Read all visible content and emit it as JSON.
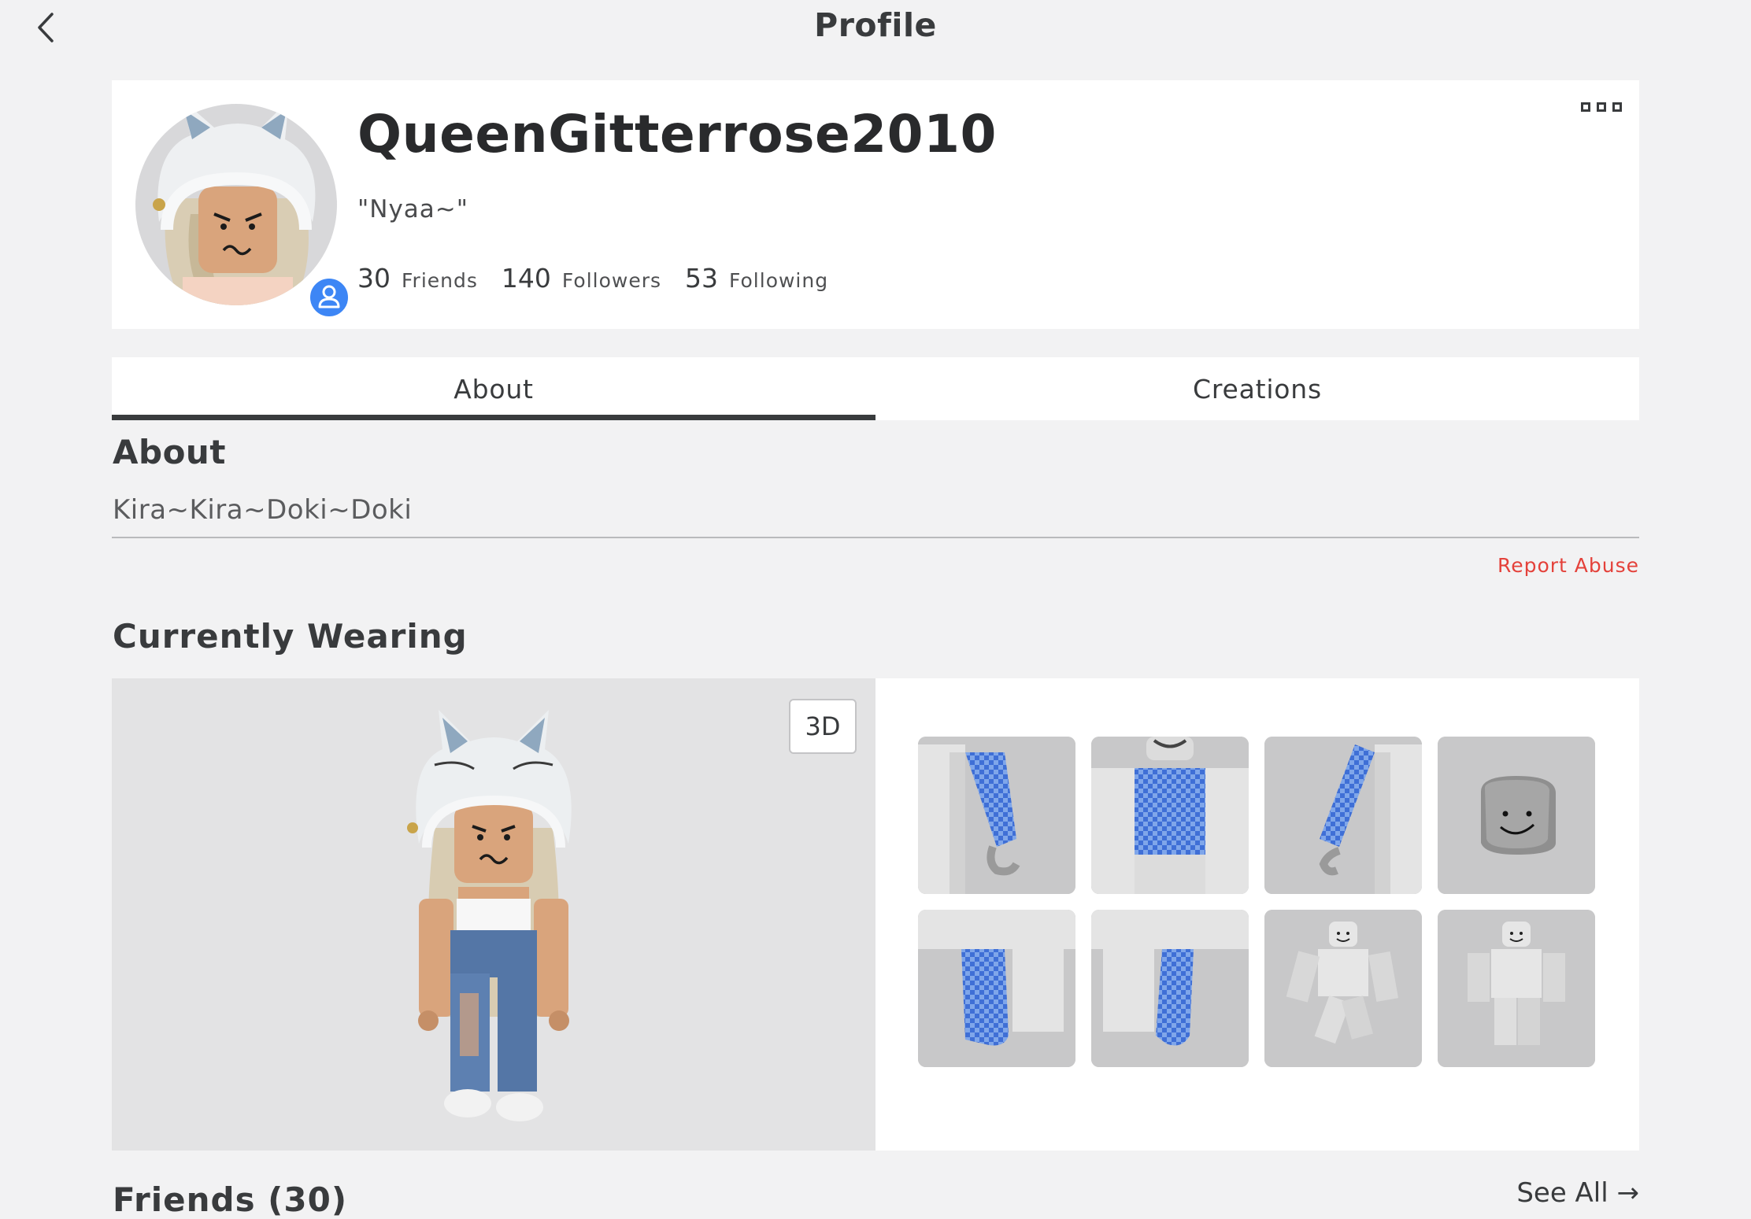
{
  "nav": {
    "title": "Profile"
  },
  "profile": {
    "username": "QueenGitterrose2010",
    "display_name": "\"Nyaa~\"",
    "stats": [
      {
        "count": "30",
        "label": "Friends"
      },
      {
        "count": "140",
        "label": "Followers"
      },
      {
        "count": "53",
        "label": "Following"
      }
    ]
  },
  "tabs": [
    {
      "label": "About",
      "active": true
    },
    {
      "label": "Creations",
      "active": false
    }
  ],
  "about": {
    "heading": "About",
    "text": "Kira~Kira~Doki~Doki",
    "report_label": "Report Abuse"
  },
  "wearing": {
    "heading": "Currently Wearing",
    "toggle_3d_label": "3D",
    "items": [
      {
        "icon": "left-arm-blue-checker"
      },
      {
        "icon": "torso-blue-checker"
      },
      {
        "icon": "right-arm-blue-checker"
      },
      {
        "icon": "smiley-head"
      },
      {
        "icon": "left-leg-blue-checker"
      },
      {
        "icon": "right-leg-blue-checker"
      },
      {
        "icon": "running-body"
      },
      {
        "icon": "standing-body"
      }
    ]
  },
  "friends": {
    "heading": "Friends (30)",
    "see_all_label": "See All →"
  },
  "colors": {
    "accent_blue": "#3d86f5",
    "report_red": "#e2231a",
    "checker_blue": "#4b7fe0"
  }
}
